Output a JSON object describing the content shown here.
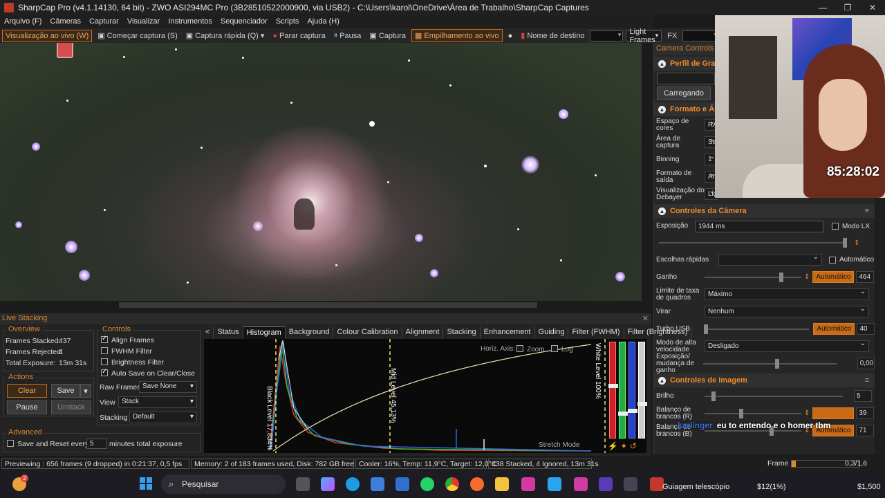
{
  "window": {
    "title": "SharpCap Pro (v4.1.14130, 64 bit) - ZWO ASI294MC Pro (3B28510522000900, via USB2) - C:\\Users\\karol\\OneDrive\\Área de Trabalho\\SharpCap Captures",
    "minimize": "—",
    "maximize": "❐",
    "close": "✕"
  },
  "menu": [
    "Arquivo (F)",
    "Câmeras",
    "Capturar",
    "Visualizar",
    "Instrumentos",
    "Sequenciador",
    "Scripts",
    "Ajuda (H)"
  ],
  "toolbar": {
    "live_view": "Visualização ao vivo (W)",
    "start_capture": "Começar captura (S)",
    "quick_capture": "Captura rápida (Q)",
    "stop_capture": "Parar captura",
    "pause": "Pausa",
    "capture": "Captura",
    "live_stacking": "Empilhamento ao vivo",
    "target_name": "Nome de destino",
    "frame_type": "Light Frames",
    "fx": "FX"
  },
  "right_panel": {
    "header": "Camera Controls",
    "capture_profile": {
      "title": "Perfil de Gravação",
      "load_button": "Carregando"
    },
    "format": {
      "title": "Formato e Área",
      "color_space_label": "Espaço de cores",
      "color_space_value": "RA",
      "capture_area_label": "Área de captura",
      "capture_area_value": "Sele",
      "binning_label": "Binning",
      "binning_value": "1",
      "output_format_label": "Formato de saída",
      "output_format_value": "Ar",
      "debayer_label": "Visualização do Debayer",
      "debayer_value": "Lig"
    },
    "camera": {
      "title": "Controles da Câmera",
      "exposure_label": "Exposição",
      "exposure_value": "1944 ms",
      "lx_mode": "Modo LX",
      "quick_picks_label": "Escolhas rápidas",
      "auto_label": "Automático",
      "gain_label": "Ganho",
      "gain_auto": "Automático",
      "gain_value": "464",
      "frame_rate_label": "Limite de taxa de quadros",
      "frame_rate_value": "Máximo",
      "flip_label": "Virar",
      "flip_value": "Nenhum",
      "usb_label": "Turbo USB",
      "usb_auto": "Automático",
      "usb_value": "40",
      "hispeed_label": "Modo de alta velocidade",
      "hispeed_value": "Desligado",
      "exp_change_label": "Exposição/ mudança de ganho",
      "exp_change_value": "0,00"
    },
    "image": {
      "title": "Controles de Imagem",
      "brightness_label": "Brilho",
      "brightness_value": "5",
      "wb_r_label": "Balanço de brancos (R)",
      "wb_r_value": "39",
      "wb_b_label": "Balanço de brancos (B)",
      "wb_b_auto": "Automático",
      "wb_b_value": "71"
    }
  },
  "webcam": {
    "timer": "85:28:02"
  },
  "chat": {
    "user": "karlinger",
    "message": "eu to entendo e o homer tbm"
  },
  "live_stacking": {
    "header": "Live Stacking",
    "overview": {
      "title": "Overview",
      "frames_stacked_label": "Frames Stacked:",
      "frames_stacked": "437",
      "frames_rejected_label": "Frames Rejected:",
      "frames_rejected": "4",
      "total_exposure_label": "Total Exposure:",
      "total_exposure": "13m 31s"
    },
    "actions": {
      "title": "Actions",
      "clear": "Clear",
      "save": "Save",
      "pause": "Pause",
      "unstack": "Unstack"
    },
    "advanced": {
      "title": "Advanced",
      "save_reset": "Save and Reset every",
      "minutes_value": "5",
      "minutes_label": "minutes total exposure"
    },
    "controls": {
      "title": "Controls",
      "align": "Align Frames",
      "fwhm": "FWHM Filter",
      "brightness": "Brightness Filter",
      "autosave": "Auto Save on Clear/Close",
      "raw_frames_label": "Raw Frames",
      "raw_frames_value": "Save None",
      "view_label": "View",
      "view_value": "Stack",
      "stacking_label": "Stacking",
      "stacking_value": "Default"
    },
    "tabs": [
      "Status",
      "Histogram",
      "Background",
      "Colour Calibration",
      "Alignment",
      "Stacking",
      "Enhancement",
      "Guiding",
      "Filter (FWHM)",
      "Filter (Brightness)"
    ],
    "histogram": {
      "horiz_axis": "Horiz. Axis:",
      "zoom": "Zoom",
      "log": "Log",
      "black_level": "Black Level 17,834%",
      "mid_level": "Mid Level 45,13%",
      "white_level": "White Level 100%",
      "stretch_mode": "Stretch Mode"
    }
  },
  "statusbar": {
    "previewing": "Previewing : 656 frames (9 dropped) in 0:21:37, 0,5 fps",
    "memory": "Memory: 2 of 183 frames used, Disk: 782 GB free",
    "cooler": "Cooler: 16%, Temp: 11,9°C, Target: 12,0°C",
    "stacked": "438 Stacked, 4 Ignored, 13m 31s",
    "frame_label": "Frame :",
    "frame_value": "0,3/1,6"
  },
  "taskbar": {
    "search": "Pesquisar",
    "app_title": "Guiagem telescópio",
    "price1": "$12(1%)",
    "price2": "$1,500",
    "badge": "2"
  }
}
